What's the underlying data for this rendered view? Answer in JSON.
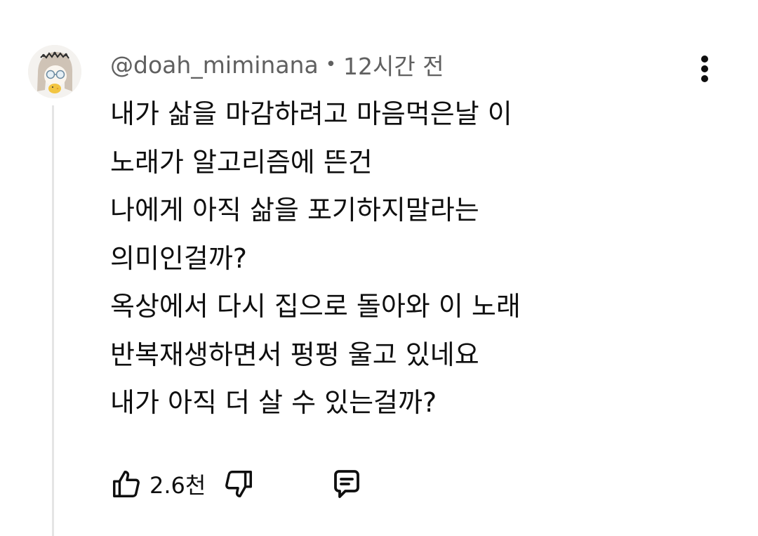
{
  "comment": {
    "author": "@doah_miminana",
    "separator": "•",
    "time": "12시간 전",
    "lines": [
      "내가 삶을 마감하려고 마음먹은날 이",
      "노래가 알고리즘에 뜬건",
      "나에게 아직 삶을 포기하지말라는",
      "의미인걸까?",
      "옥상에서 다시 집으로 돌아와 이 노래",
      "반복재생하면서 펑펑 울고 있네요",
      "내가 아직 더 살 수 있는걸까?"
    ],
    "like_count": "2.6천"
  },
  "icons": {
    "avatar": "avatar-image",
    "menu": "more-vert-icon",
    "like": "thumb-up-icon",
    "dislike": "thumb-down-icon",
    "reply": "comment-reply-icon"
  },
  "colors": {
    "text_primary": "#0f0f0f",
    "text_secondary": "#606060",
    "thread_line": "#e5e5e5"
  }
}
